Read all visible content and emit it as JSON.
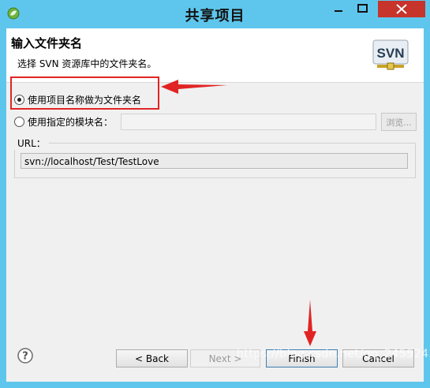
{
  "window": {
    "title": "共享项目"
  },
  "banner": {
    "title": "输入文件夹名",
    "description": "选择 SVN 资源库中的文件夹名。",
    "logo_text": "SVN"
  },
  "options": {
    "use_project_name_label": "使用项目名称做为文件夹名",
    "use_project_name_selected": true,
    "use_module_name_label": "使用指定的模块名：",
    "use_module_name_selected": false,
    "module_name_value": "",
    "browse_label": "浏览..."
  },
  "url_group": {
    "legend": "URL：",
    "value": "svn://localhost/Test/TestLove"
  },
  "buttons": {
    "help_glyph": "?",
    "back": "< Back",
    "next": "Next >",
    "finish": "Finish",
    "cancel": "Cancel"
  },
  "watermark": "https://blog.csdn.net/qq_24552437",
  "colors": {
    "titlebar": "#5ec6ec",
    "close_button": "#c7342b",
    "annotation_red": "#e02424"
  }
}
